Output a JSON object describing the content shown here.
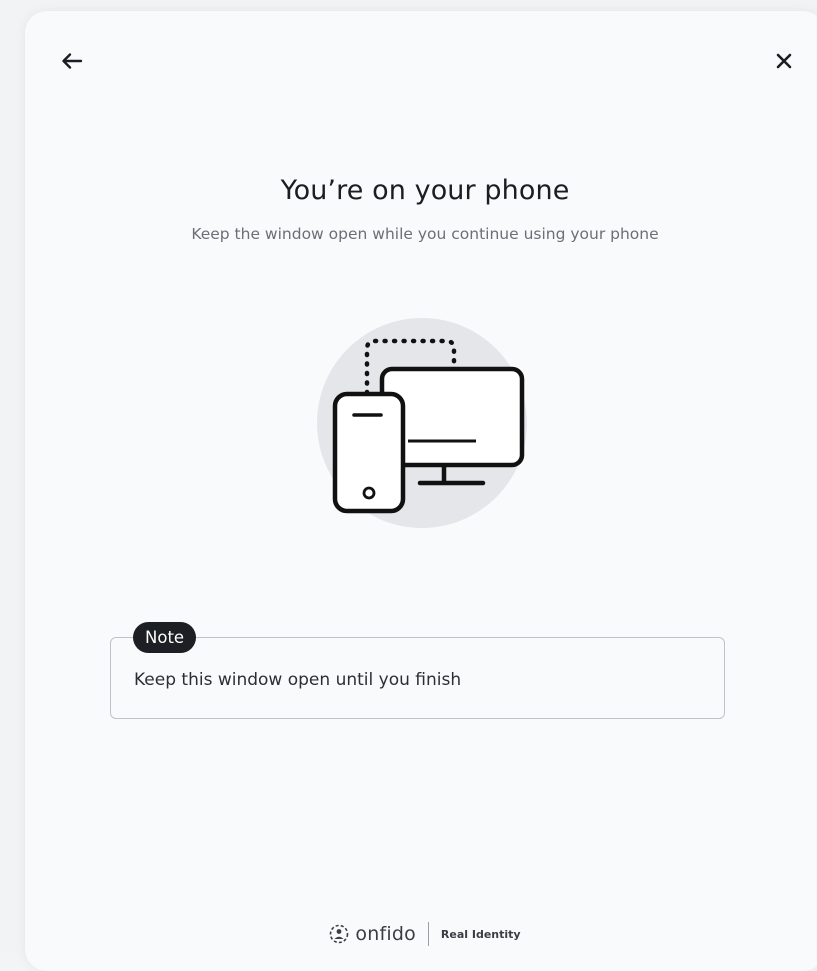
{
  "header": {
    "back_icon": "arrow-left-icon",
    "close_icon": "close-icon"
  },
  "main": {
    "title": "You’re on your phone",
    "subtitle": "Keep the window open while you continue using your phone",
    "illustration_icon": "phone-to-computer-icon"
  },
  "note": {
    "badge_label": "Note",
    "text": "Keep this window open until you finish"
  },
  "footer": {
    "logo_icon": "onfido-logo-icon",
    "brand_name": "onfido",
    "tagline": "Real Identity"
  },
  "colors": {
    "badge_bg": "#1c1f24",
    "illustration_circle": "#e4e6ea",
    "text_primary": "#1a1d21",
    "text_secondary": "#6b6f76"
  }
}
